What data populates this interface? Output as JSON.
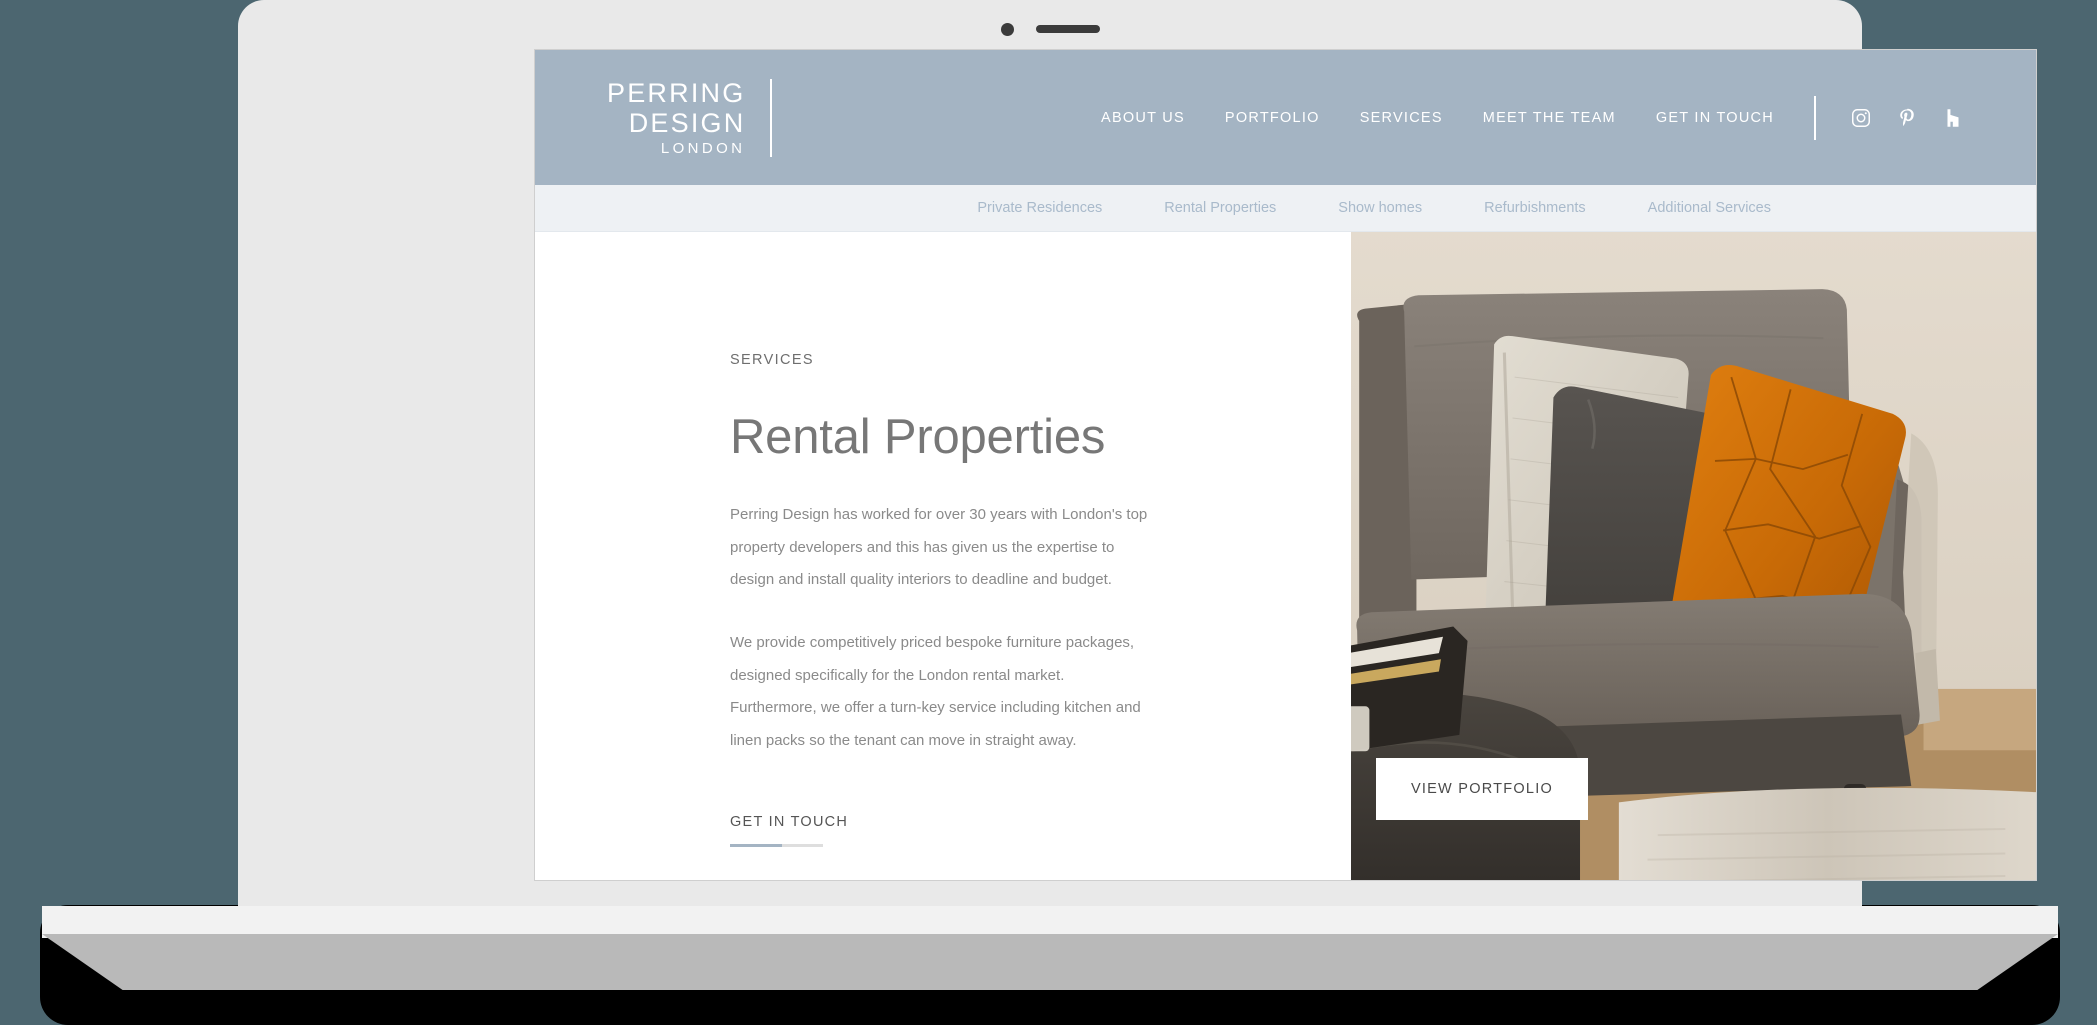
{
  "background_color": "#4c6670",
  "device": {
    "name": "laptop-mockup",
    "bezel_color": "#e9e9e9",
    "base_color": "#b9b9b9"
  },
  "header": {
    "background_color": "#a4b4c3",
    "logo": {
      "line1": "PERRING",
      "line2": "DESIGN",
      "line3": "LONDON"
    },
    "nav": [
      {
        "label": "ABOUT US"
      },
      {
        "label": "PORTFOLIO"
      },
      {
        "label": "SERVICES"
      },
      {
        "label": "MEET THE TEAM"
      },
      {
        "label": "GET IN TOUCH"
      }
    ],
    "socials": [
      {
        "name": "instagram-icon"
      },
      {
        "name": "pinterest-icon"
      },
      {
        "name": "houzz-icon"
      }
    ]
  },
  "sub_nav": {
    "background_color": "#eef1f4",
    "text_color": "#a9bacb",
    "items": [
      {
        "label": "Private Residences"
      },
      {
        "label": "Rental Properties"
      },
      {
        "label": "Show homes"
      },
      {
        "label": "Refurbishments"
      },
      {
        "label": "Additional Services"
      }
    ]
  },
  "main": {
    "eyebrow": "SERVICES",
    "headline": "Rental Properties",
    "paragraphs": [
      "Perring Design has worked for over 30 years with London's top property developers and this has given us the expertise to design and install quality interiors to deadline and budget.",
      "We provide competitively priced bespoke furniture packages, designed specifically for the London rental market.  Furthermore, we offer a turn-key service including kitchen and linen packs so the tenant can move in straight away."
    ],
    "cta": {
      "label": "GET IN TOUCH",
      "underline_accent_color": "#a4b4c3",
      "underline_track_color": "#dedede"
    }
  },
  "photo": {
    "alt": "grey-sofa-with-cushions-interior",
    "button": {
      "label": "VIEW PORTFOLIO"
    },
    "palette": {
      "wall": "#ded5c8",
      "sofa": "#7d756c",
      "cushion_cream": "#d8d2c6",
      "cushion_charcoal": "#4a4642",
      "cushion_orange": "#d4720c",
      "ottoman": "#3b3732",
      "rug": "#ddd6cb",
      "floor": "#b9956a"
    }
  }
}
